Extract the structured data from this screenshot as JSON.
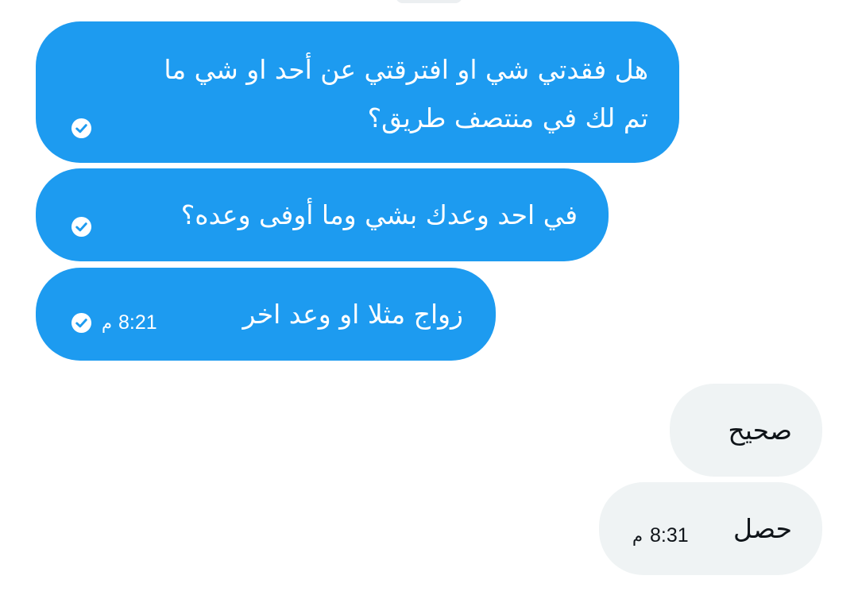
{
  "conversation": {
    "messages": [
      {
        "direction": "sent",
        "lines": [
          "هل فقدتي شي او افترقتي عن أحد او شي ما",
          "تم لك في منتصف طريق؟"
        ],
        "status_icon": "check-circle-icon"
      },
      {
        "direction": "sent",
        "text": "في احد وعدك بشي وما أوفى وعده؟",
        "status_icon": "check-circle-icon"
      },
      {
        "direction": "sent",
        "text": "زواج مثلا او وعد اخر",
        "time": "8:21",
        "pm": "م",
        "status_icon": "check-circle-icon"
      },
      {
        "direction": "received",
        "text": "صحيح"
      },
      {
        "direction": "received",
        "text": "حصل",
        "time": "8:31",
        "pm": "م"
      }
    ]
  },
  "colors": {
    "sent_bubble": "#1d9bf0",
    "sent_text": "#ffffff",
    "received_bubble": "#eff3f4",
    "received_text": "#0f1419"
  }
}
